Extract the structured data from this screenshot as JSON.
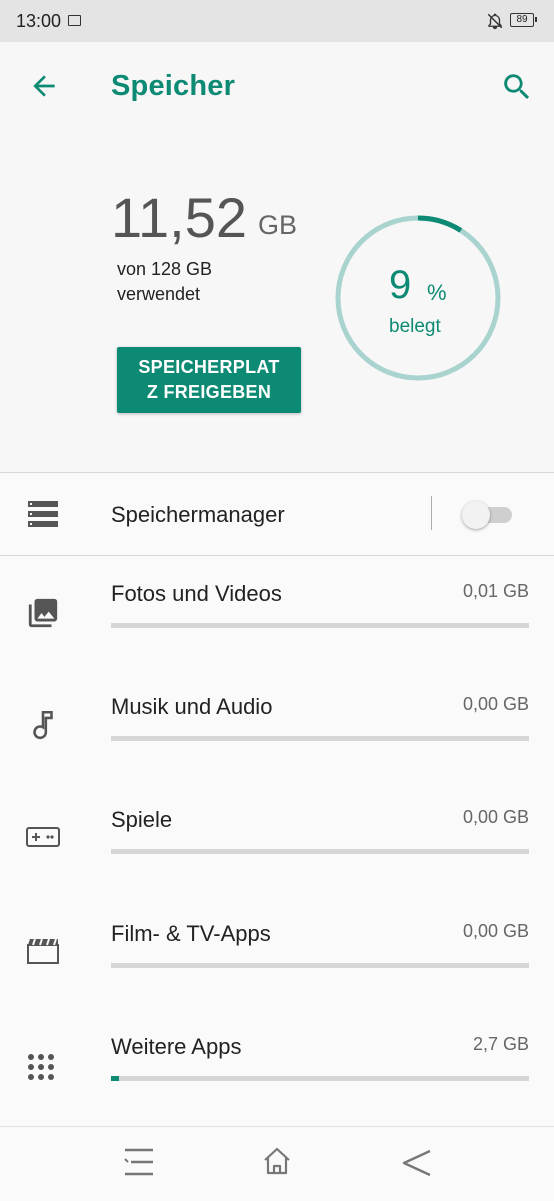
{
  "status": {
    "time": "13:00",
    "battery": "89"
  },
  "header": {
    "title": "Speicher"
  },
  "summary": {
    "used_value": "11,52",
    "used_unit": "GB",
    "of_total": "von 128 GB",
    "used_label": "verwendet",
    "free_button_line1": "SPEICHERPLAT",
    "free_button_line2": "Z FREIGEBEN",
    "percent_value": "9",
    "percent_sign": "%",
    "percent_label": "belegt",
    "percent_used": 0.09
  },
  "manager": {
    "label": "Speichermanager",
    "enabled": false
  },
  "categories": [
    {
      "label": "Fotos und Videos",
      "size": "0,01 GB",
      "icon": "photo-library-icon",
      "fill": 0.0
    },
    {
      "label": "Musik und Audio",
      "size": "0,00 GB",
      "icon": "music-note-icon",
      "fill": 0.0
    },
    {
      "label": "Spiele",
      "size": "0,00 GB",
      "icon": "gamepad-icon",
      "fill": 0.0
    },
    {
      "label": "Film- & TV-Apps",
      "size": "0,00 GB",
      "icon": "movie-icon",
      "fill": 0.0
    },
    {
      "label": "Weitere Apps",
      "size": "2,7 GB",
      "icon": "apps-grid-icon",
      "fill": 0.02
    }
  ],
  "colors": {
    "accent": "#0d8a73",
    "ring_track": "#a9d3cf",
    "bar_track": "#d6d6d6"
  }
}
